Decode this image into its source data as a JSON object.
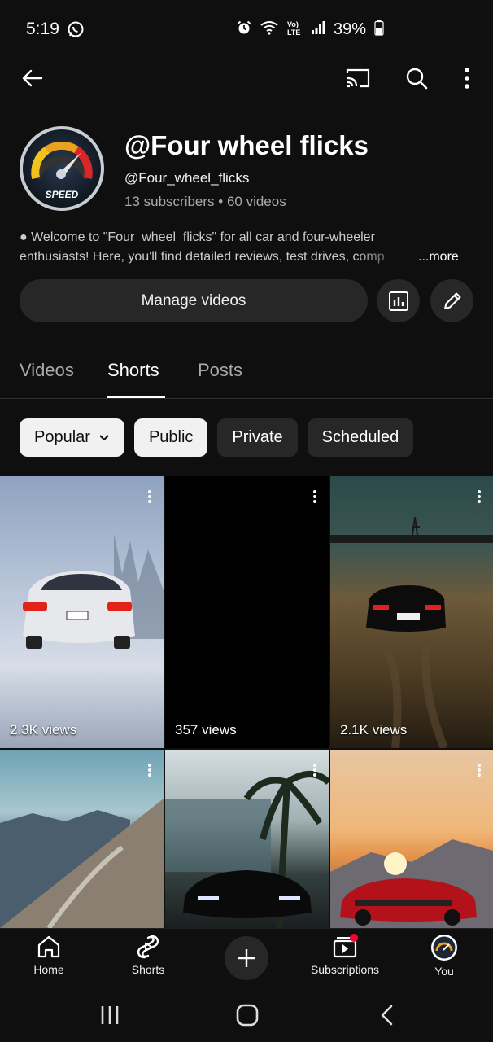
{
  "status": {
    "time": "5:19",
    "battery": "39%"
  },
  "channel": {
    "name": "@Four wheel flicks",
    "handle": "@Four_wheel_flicks",
    "meta": "13 subscribers • 60 videos",
    "avatar_text": "SPEED",
    "description_line1": "● Welcome to \"Four_wheel_flicks\" for all car and four-wheeler",
    "description_line2": "enthusiasts! Here, you'll find detailed reviews, test drives, comp",
    "more_label": "...more"
  },
  "actions": {
    "manage_label": "Manage videos"
  },
  "tabs": [
    {
      "label": "Videos"
    },
    {
      "label": "Shorts"
    },
    {
      "label": "Posts"
    }
  ],
  "chips": [
    {
      "label": "Popular"
    },
    {
      "label": "Public"
    },
    {
      "label": "Private"
    },
    {
      "label": "Scheduled"
    }
  ],
  "shorts": [
    {
      "views": "2.3K views"
    },
    {
      "views": "357 views"
    },
    {
      "views": "2.1K views"
    },
    {
      "views": ""
    },
    {
      "views": ""
    },
    {
      "views": ""
    }
  ],
  "bottom_nav": [
    {
      "label": "Home"
    },
    {
      "label": "Shorts"
    },
    {
      "label": "Subscriptions"
    },
    {
      "label": "You"
    }
  ]
}
